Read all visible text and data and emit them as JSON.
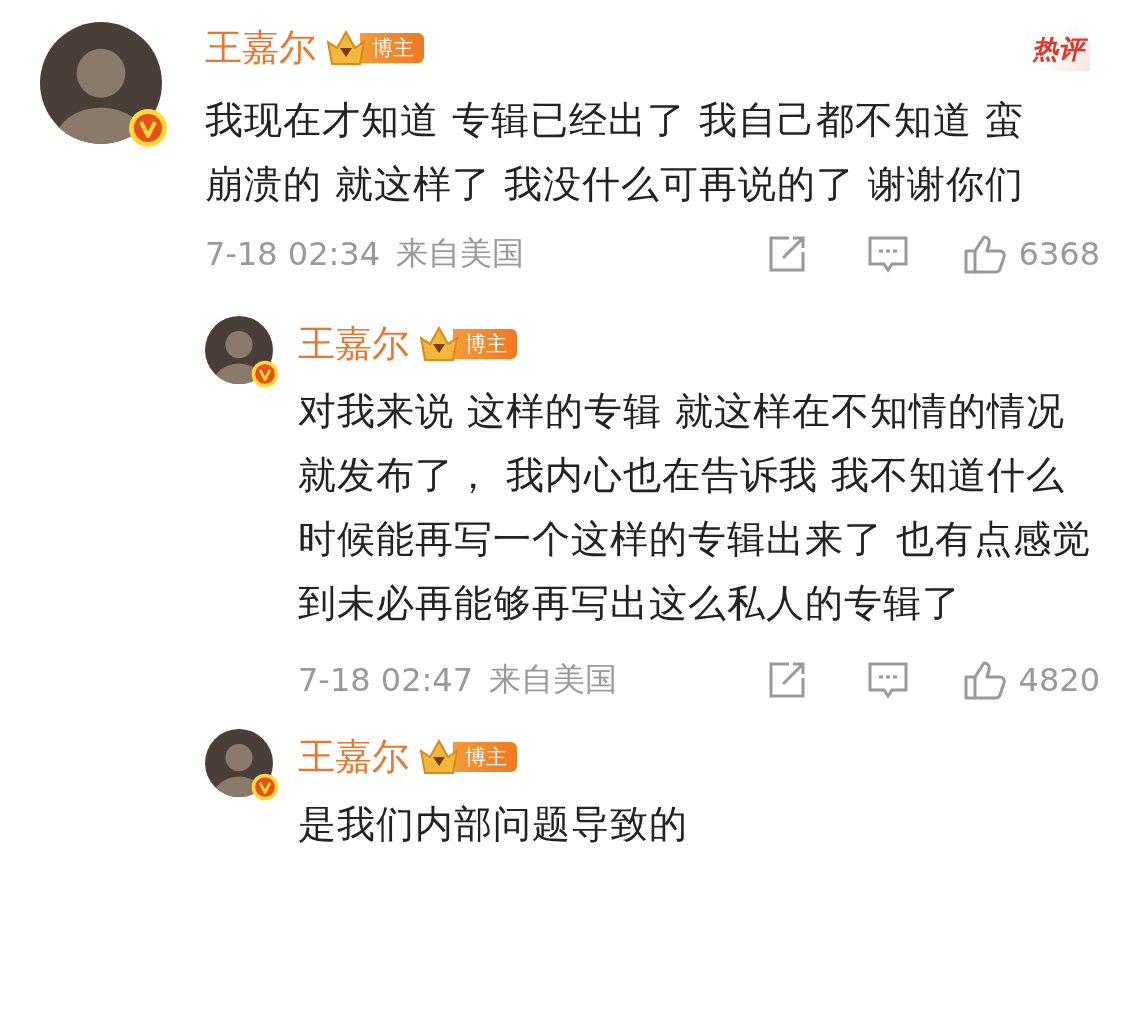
{
  "hot_label": "热评",
  "comments": [
    {
      "author": "王嘉尔",
      "badge": "博主",
      "verified": true,
      "text": "我现在才知道 专辑已经出了 我自己都不知道 蛮崩溃的  就这样了 我没什么可再说的了  谢谢你们",
      "time": "7-18 02:34",
      "location": "来自美国",
      "likes": "6368",
      "replies": [
        {
          "author": "王嘉尔",
          "badge": "博主",
          "verified": true,
          "text": "对我来说 这样的专辑 就这样在不知情的情况就发布了， 我内心也在告诉我 我不知道什么时候能再写一个这样的专辑出来了 也有点感觉到未必再能够再写出这么私人的专辑了",
          "time": "7-18 02:47",
          "location": "来自美国",
          "likes": "4820"
        },
        {
          "author": "王嘉尔",
          "badge": "博主",
          "verified": true,
          "text": "是我们内部问题导致的"
        }
      ]
    }
  ]
}
